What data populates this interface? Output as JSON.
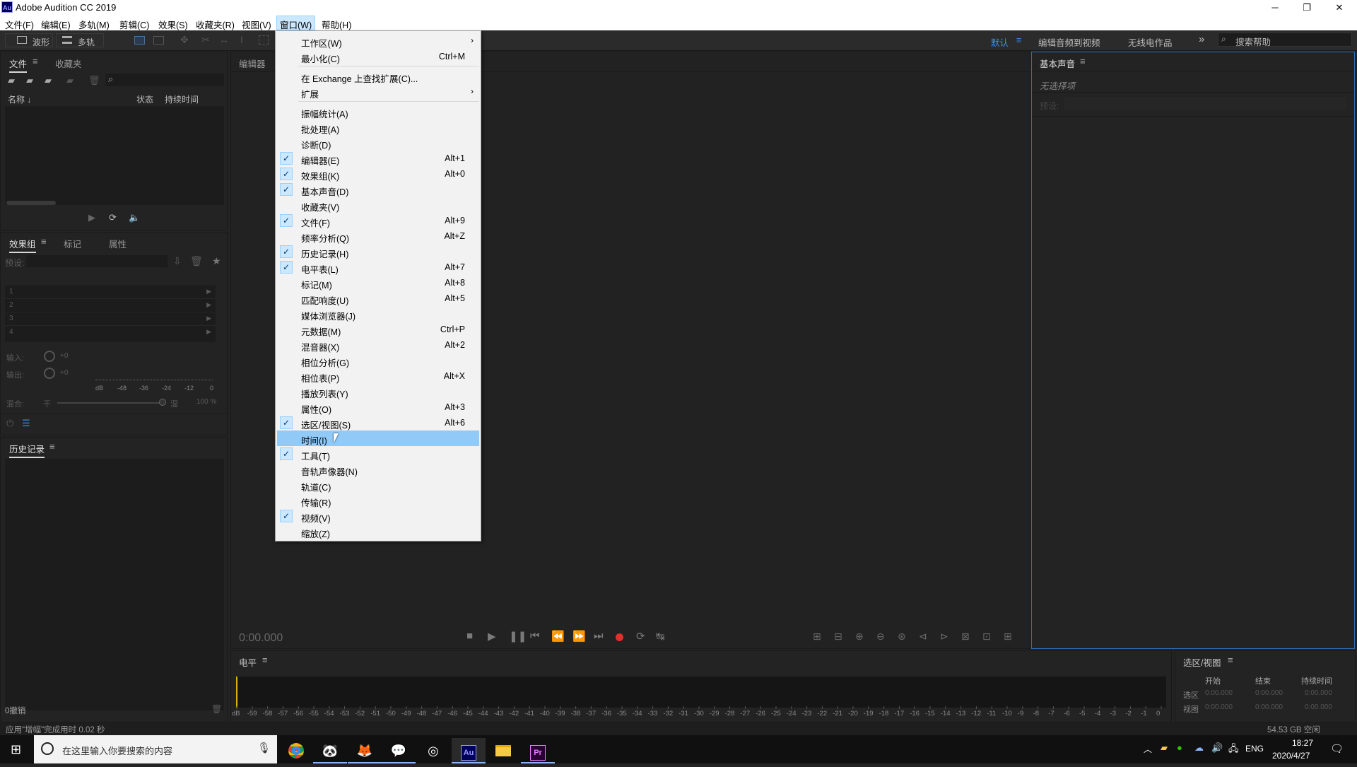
{
  "window": {
    "title": "Adobe Audition CC 2019",
    "icon_text": "Au",
    "minimize": "─",
    "maximize": "❐",
    "close": "✕"
  },
  "menubar": [
    "文件(F)",
    "编辑(E)",
    "多轨(M)",
    "剪辑(C)",
    "效果(S)",
    "收藏夹(R)",
    "视图(V)",
    "窗口(W)",
    "帮助(H)"
  ],
  "toolbar": {
    "waveform": "波形",
    "multitrack": "多轨",
    "workspaces": [
      "默认",
      "编辑音频到视频",
      "无线电作品"
    ],
    "overflow": "»",
    "help_search": "搜索帮助"
  },
  "files_panel": {
    "tabs": [
      "文件",
      "收藏夹"
    ],
    "columns": {
      "name": "名称 ↓",
      "status": "状态",
      "duration": "持续时间"
    }
  },
  "effects_panel": {
    "tabs": [
      "效果组",
      "标记",
      "属性"
    ],
    "preset_label": "预设:",
    "slots": [
      "1",
      "2",
      "3",
      "4"
    ],
    "input_label": "输入:",
    "input_value": "+0",
    "output_label": "输出:",
    "output_value": "+0",
    "meter_labels": [
      "dB",
      "-48",
      "-36",
      "-24",
      "-12",
      "0"
    ],
    "mix_label": "混合:",
    "mix_dry": "干",
    "mix_wet": "湿",
    "mix_value": "100 %"
  },
  "history_panel": {
    "title": "历史记录",
    "undo_count": "0撤销"
  },
  "editor_panel": {
    "title": "编辑器",
    "timecode": "0:00.000"
  },
  "essential_sound": {
    "title": "基本声音",
    "no_selection": "无选择项",
    "preset_label": "预设:"
  },
  "level_panel": {
    "title": "电平",
    "scale": [
      "dB",
      "-59",
      "-58",
      "-57",
      "-56",
      "-55",
      "-54",
      "-53",
      "-52",
      "-51",
      "-50",
      "-49",
      "-48",
      "-47",
      "-46",
      "-45",
      "-44",
      "-43",
      "-42",
      "-41",
      "-40",
      "-39",
      "-38",
      "-37",
      "-36",
      "-35",
      "-34",
      "-33",
      "-32",
      "-31",
      "-30",
      "-29",
      "-28",
      "-27",
      "-26",
      "-25",
      "-24",
      "-23",
      "-22",
      "-21",
      "-20",
      "-19",
      "-18",
      "-17",
      "-16",
      "-15",
      "-14",
      "-13",
      "-12",
      "-11",
      "-10",
      "-9",
      "-8",
      "-7",
      "-6",
      "-5",
      "-4",
      "-3",
      "-2",
      "-1",
      "0"
    ]
  },
  "selection_view": {
    "title": "选区/视图",
    "headers": [
      "开始",
      "结束",
      "持续时间"
    ],
    "rows": [
      {
        "label": "选区",
        "start": "0:00.000",
        "end": "0:00.000",
        "duration": "0:00.000"
      },
      {
        "label": "视图",
        "start": "0:00.000",
        "end": "0:00.000",
        "duration": "0:00.000"
      }
    ]
  },
  "status": {
    "message": "应用\"增幅\"完成用时 0.02 秒",
    "disk": "54.53 GB 空闲"
  },
  "window_menu": {
    "groups": [
      [
        {
          "label": "工作区(W)",
          "submenu": true
        },
        {
          "label": "最小化(C)",
          "shortcut": "Ctrl+M"
        }
      ],
      [
        {
          "label": "在 Exchange 上查找扩展(C)..."
        },
        {
          "label": "扩展",
          "submenu": true
        }
      ],
      [
        {
          "label": "振幅统计(A)"
        },
        {
          "label": "批处理(A)"
        },
        {
          "label": "诊断(D)"
        },
        {
          "label": "编辑器(E)",
          "shortcut": "Alt+1",
          "checked": true
        },
        {
          "label": "效果组(K)",
          "shortcut": "Alt+0",
          "checked": true
        },
        {
          "label": "基本声音(D)",
          "checked": true
        },
        {
          "label": "收藏夹(V)"
        },
        {
          "label": "文件(F)",
          "shortcut": "Alt+9",
          "checked": true
        },
        {
          "label": "频率分析(Q)",
          "shortcut": "Alt+Z"
        },
        {
          "label": "历史记录(H)",
          "checked": true
        },
        {
          "label": "电平表(L)",
          "shortcut": "Alt+7",
          "checked": true
        },
        {
          "label": "标记(M)",
          "shortcut": "Alt+8"
        },
        {
          "label": "匹配响度(U)",
          "shortcut": "Alt+5"
        },
        {
          "label": "媒体浏览器(J)"
        },
        {
          "label": "元数据(M)",
          "shortcut": "Ctrl+P"
        },
        {
          "label": "混音器(X)",
          "shortcut": "Alt+2"
        },
        {
          "label": "相位分析(G)"
        },
        {
          "label": "相位表(P)",
          "shortcut": "Alt+X"
        },
        {
          "label": "播放列表(Y)"
        },
        {
          "label": "属性(O)",
          "shortcut": "Alt+3"
        },
        {
          "label": "选区/视图(S)",
          "shortcut": "Alt+6",
          "checked": true
        },
        {
          "label": "时间(I)",
          "highlighted": true
        },
        {
          "label": "工具(T)",
          "checked": true
        },
        {
          "label": "音轨声像器(N)"
        },
        {
          "label": "轨道(C)"
        },
        {
          "label": "传输(R)"
        },
        {
          "label": "视频(V)",
          "checked": true
        },
        {
          "label": "缩放(Z)"
        }
      ]
    ]
  },
  "taskbar": {
    "search_placeholder": "在这里输入你要搜索的内容",
    "apps": [
      "chrome-icon",
      "panda-icon",
      "game-icon",
      "wechat-icon",
      "obs-icon",
      "audition-icon",
      "folder-icon",
      "premiere-icon"
    ],
    "ime": "ENG",
    "time": "18:27",
    "date": "2020/4/27"
  },
  "colors": {
    "accent": "#3c8ee8",
    "menu_highlight": "#91c9f7",
    "record": "#e0302b",
    "selection_blue": "#2d6fb3"
  }
}
